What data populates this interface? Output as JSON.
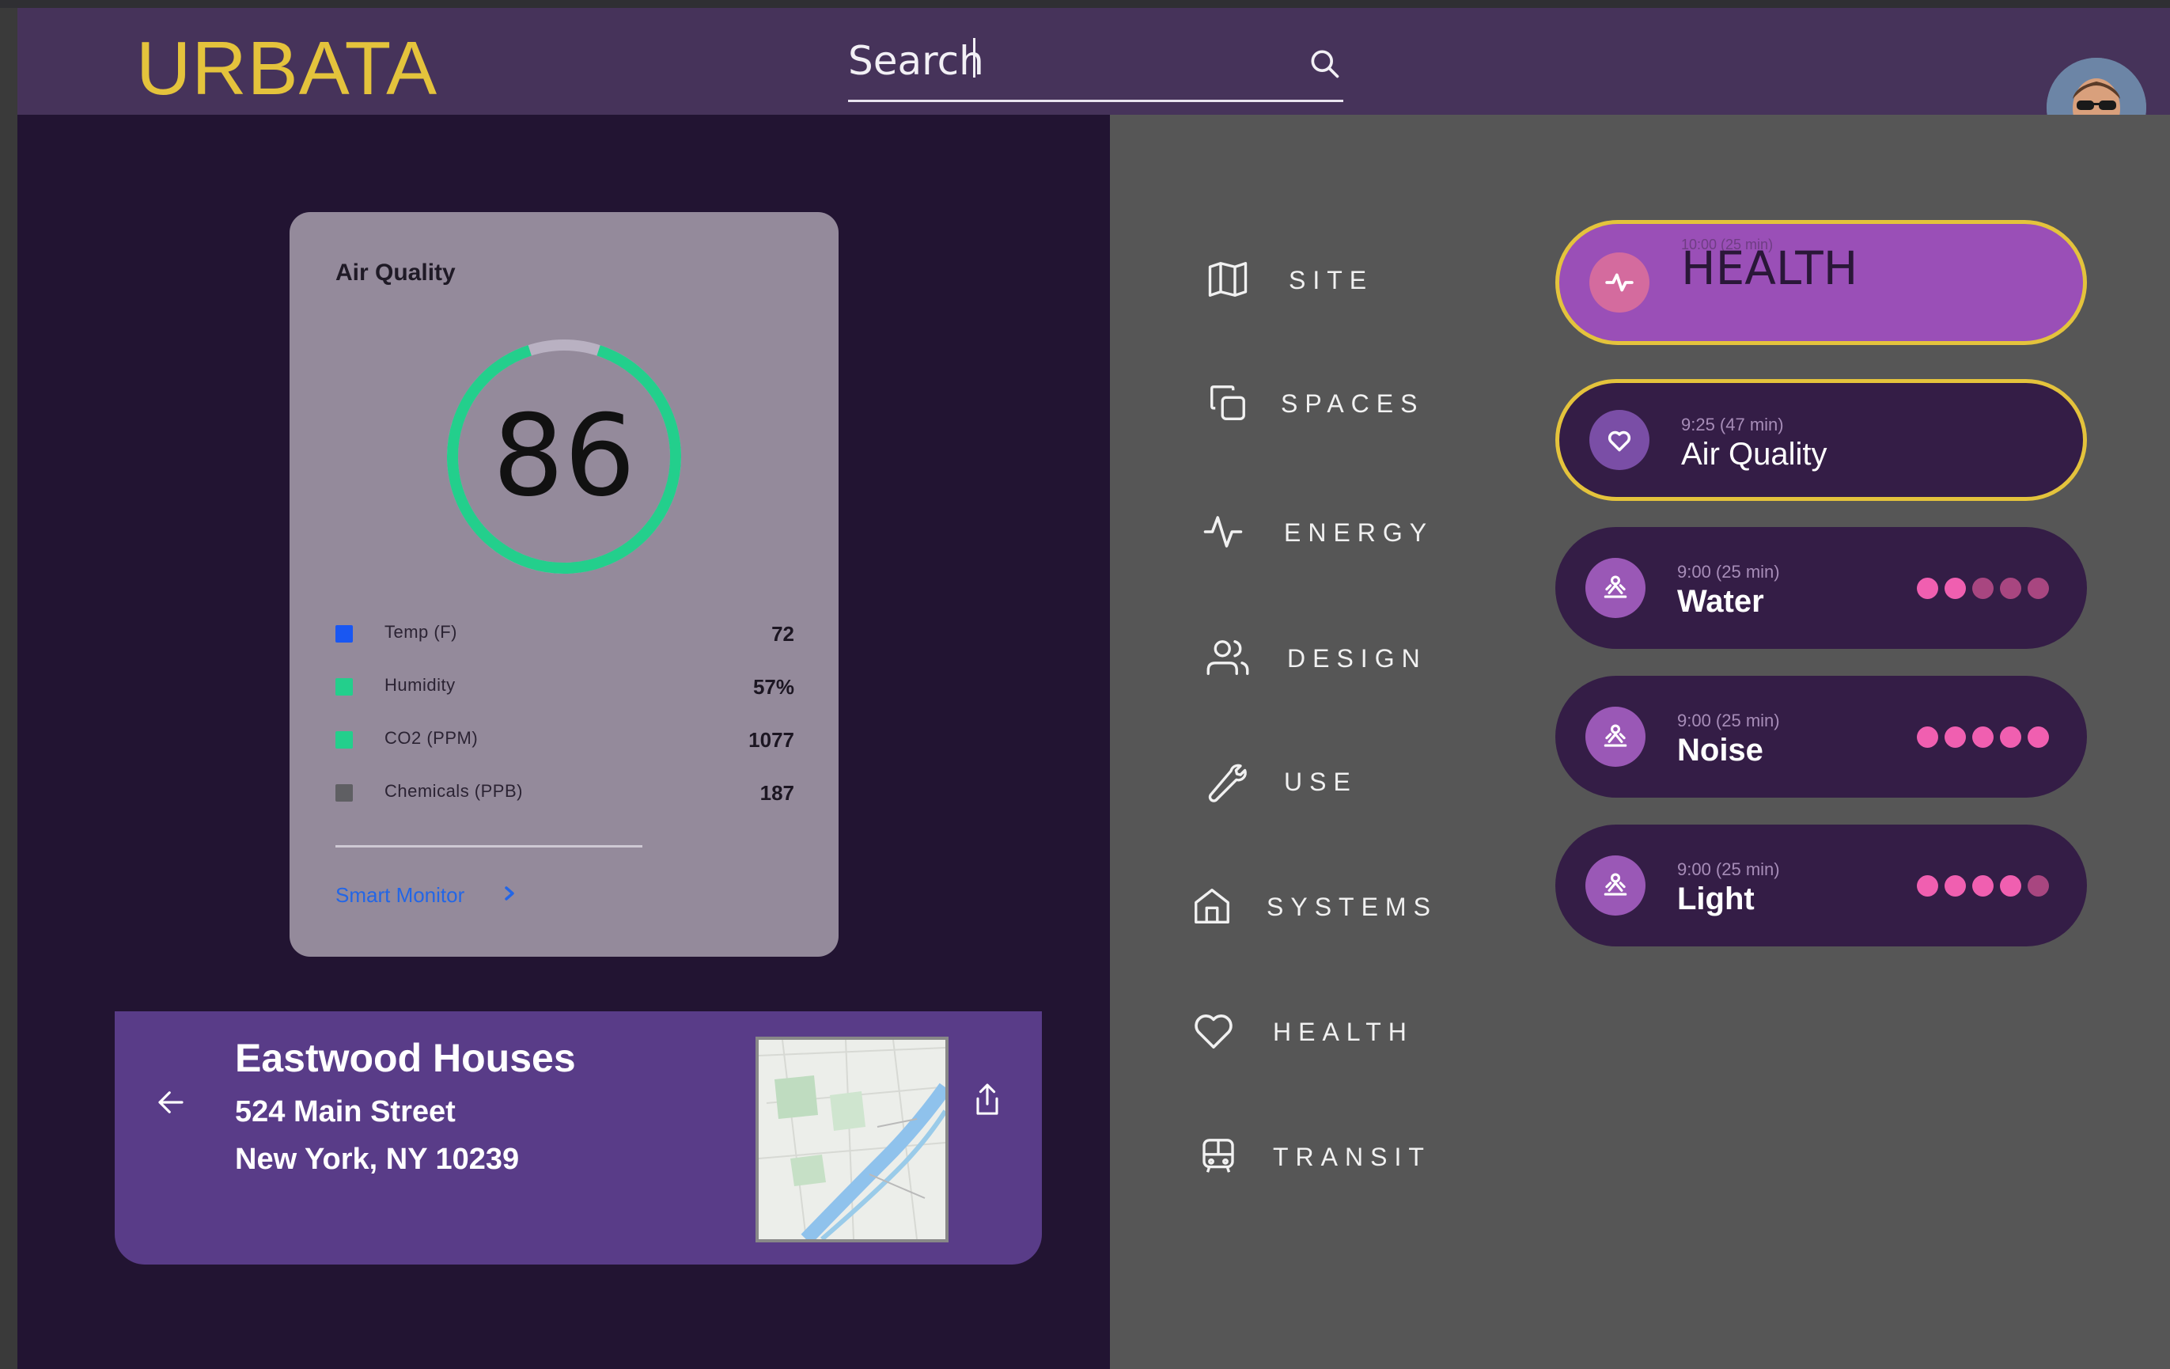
{
  "app": {
    "logo": "URBATA"
  },
  "search": {
    "value": "Search",
    "icon": "search-icon"
  },
  "user": {
    "avatar": "user-avatar"
  },
  "air_quality": {
    "title": "Air Quality",
    "score": "86",
    "gauge_fraction": 0.9,
    "rows": [
      {
        "label": "Temp (F)",
        "value": "72",
        "color": "#1957f2"
      },
      {
        "label": "Humidity",
        "value": "57%",
        "color": "#23cf8c"
      },
      {
        "label": "CO2 (PPM)",
        "value": "1077",
        "color": "#23cf8c"
      },
      {
        "label": "Chemicals (PPB)",
        "value": "187",
        "color": "#5f5f63"
      }
    ],
    "link": "Smart Monitor"
  },
  "location": {
    "name": "Eastwood Houses",
    "street": "524 Main Street",
    "city": "New York, NY 10239"
  },
  "nav": [
    {
      "label": "SITE",
      "icon": "map-icon"
    },
    {
      "label": "SPACES",
      "icon": "copy-icon"
    },
    {
      "label": "ENERGY",
      "icon": "pulse-icon"
    },
    {
      "label": "DESIGN",
      "icon": "users-icon"
    },
    {
      "label": "USE",
      "icon": "wrench-icon"
    },
    {
      "label": "SYSTEMS",
      "icon": "home-icon"
    },
    {
      "label": "HEALTH",
      "icon": "heart-icon"
    },
    {
      "label": "TRANSIT",
      "icon": "bus-icon"
    }
  ],
  "cards": [
    {
      "time": "10:00 (25 min)",
      "label": "HEALTH",
      "icon": "pulse-icon",
      "rating": null,
      "selected": true
    },
    {
      "time": "9:25 (47 min)",
      "label": "Air Quality",
      "icon": "heart-icon",
      "rating": null,
      "selected": true
    },
    {
      "time": "9:00 (25 min)",
      "label": "Water",
      "icon": "person-icon",
      "rating": 2
    },
    {
      "time": "9:00 (25 min)",
      "label": "Noise",
      "icon": "person-icon",
      "rating": 5
    },
    {
      "time": "9:00 (25 min)",
      "label": "Light",
      "icon": "person-icon",
      "rating": 4
    }
  ],
  "colors": {
    "accent": "#e4c33c",
    "health_card": "#9a4fb7",
    "dot_on": "#f05fb0",
    "dot_off": "#a84680",
    "gauge_track": "#b9b1c2",
    "gauge_fill": "#23cf8c"
  }
}
